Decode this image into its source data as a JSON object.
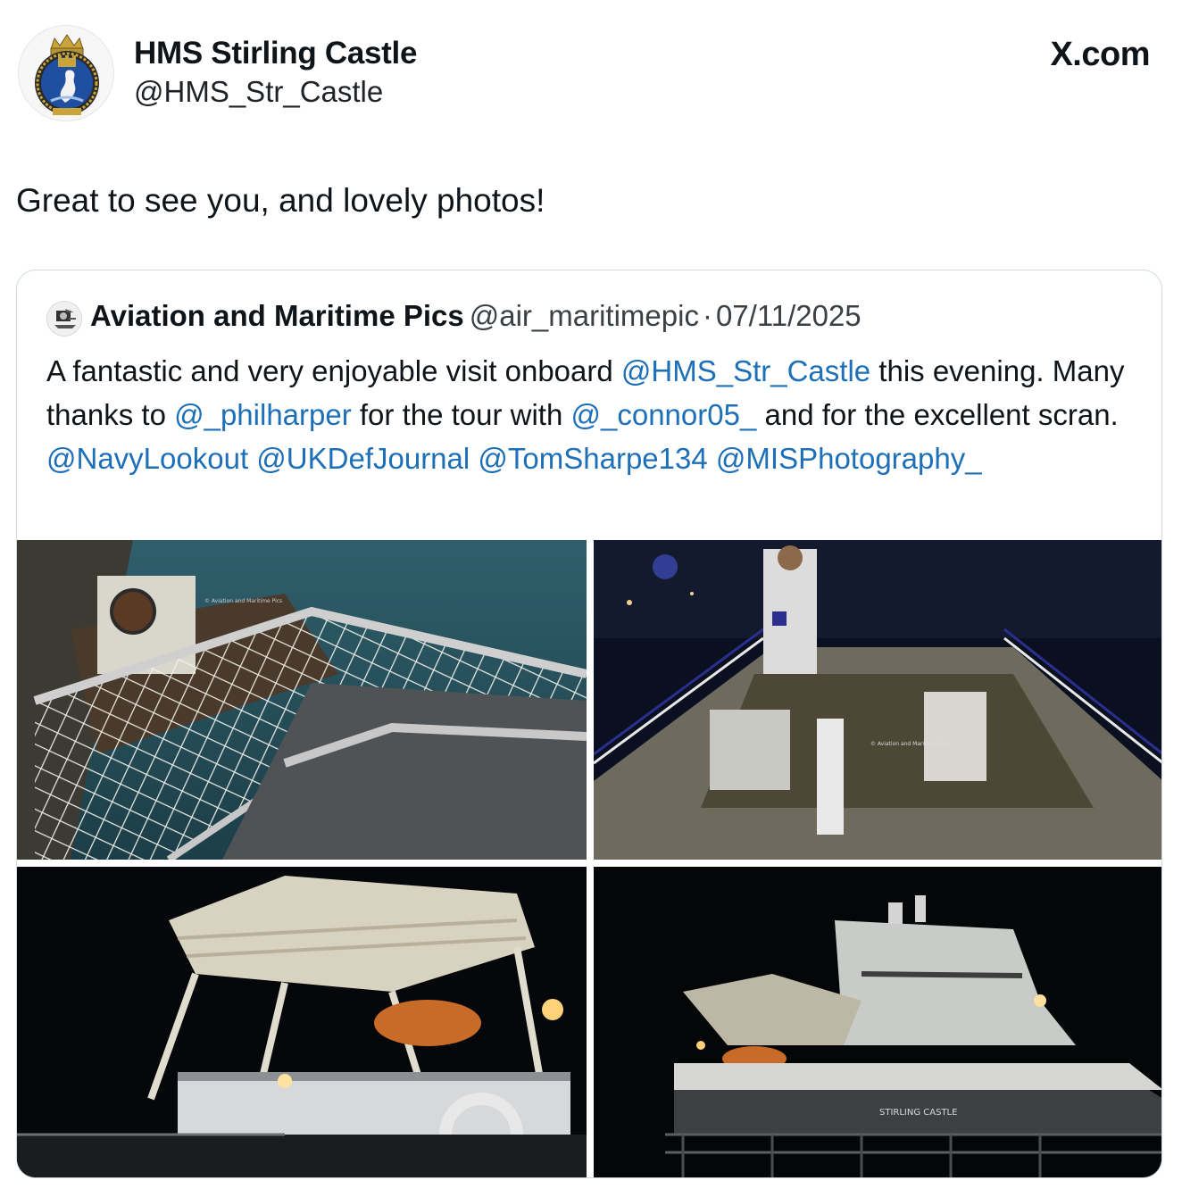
{
  "post": {
    "author_name": "HMS Stirling Castle",
    "author_handle": "@HMS_Str_Castle",
    "site": "X.com",
    "text": "Great to see you, and lovely photos!"
  },
  "quote": {
    "author_name": "Aviation and Maritime Pics",
    "author_handle": "@air_maritimepic",
    "separator": "·",
    "date": "07/11/2025",
    "text_1": "A fantastic and very enjoyable visit onboard ",
    "mention_1": "@HMS_Str_Castle",
    "text_2": " this evening. Many thanks to ",
    "mention_2": "@_philharper",
    "text_3": " for the tour with ",
    "mention_3": "@_connor05_",
    "text_4": "  and for the excellent scran. ",
    "mention_4": "@NavyLookout",
    "mention_5": "@UKDefJournal",
    "mention_6": "@TomSharpe134",
    "mention_7": "@MISPhotography_"
  },
  "photos": [
    {
      "name": "helideck-safety-net-photo",
      "watermark": "© Aviation and Maritime Pics"
    },
    {
      "name": "aft-deck-night-photo",
      "watermark": "© Aviation and Maritime Pics"
    },
    {
      "name": "helideck-lifeboat-night-photo"
    },
    {
      "name": "ship-bow-night-photo",
      "hull_lettering": "STIRLING CASTLE"
    }
  ],
  "colors": {
    "mention": "#1d6fb8",
    "border": "#cfd9de",
    "badge_blue": "#1e4fa0",
    "badge_gold": "#c9a43a"
  },
  "icons": {
    "avatar": "ship-crest-icon",
    "quote_avatar": "camera-plane-logo-icon"
  }
}
